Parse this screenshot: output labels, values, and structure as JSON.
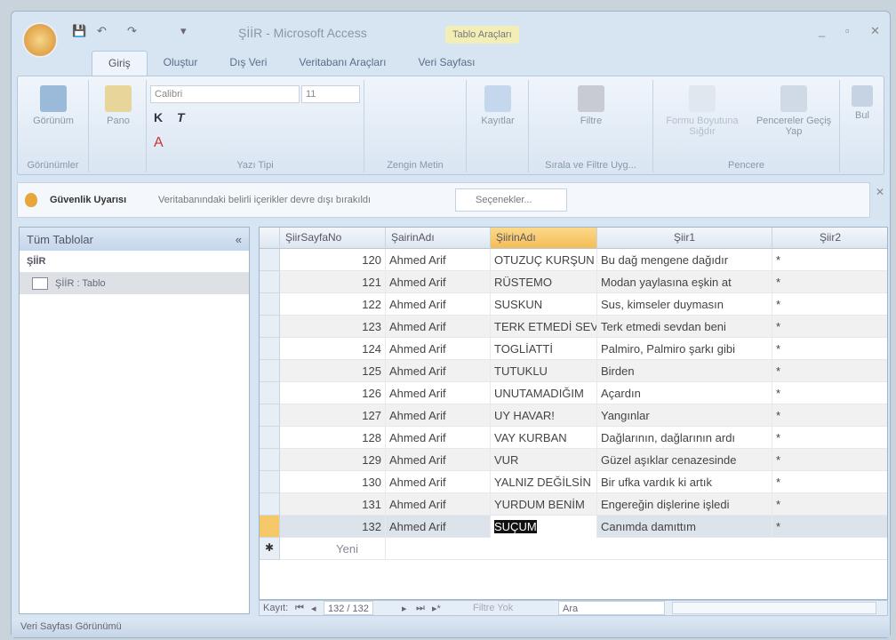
{
  "title": {
    "app": "ŞİİR - Microsoft Access",
    "context": "Tablo Araçları"
  },
  "tabs": [
    "Giriş",
    "Oluştur",
    "Dış Veri",
    "Veritabanı Araçları",
    "Veri Sayfası"
  ],
  "ribbon": {
    "view": "Görünüm",
    "paste": "Pano",
    "font_name": "Calibri",
    "font_size": "11",
    "font_group": "Yazı Tipi",
    "views_group": "Görünümler",
    "rich_text": "Zengin Metin",
    "records": "Kayıtlar",
    "filter": "Filtre",
    "sort_group": "Sırala ve Filtre Uyg...",
    "form_switch": "Formu Boyutuna Sığdır",
    "switch_windows": "Pencereler Geçiş Yap",
    "window_group": "Pencere",
    "find": "Bul"
  },
  "security": {
    "title": "Güvenlik Uyarısı",
    "message": "Veritabanındaki belirli içerikler devre dışı bırakıldı",
    "options": "Seçenekler..."
  },
  "nav": {
    "header": "Tüm Tablolar",
    "group": "ŞİİR",
    "item": "ŞİİR : Tablo"
  },
  "columns": [
    "ŞiirSayfaNo",
    "ŞairinAdı",
    "ŞiirinAdı",
    "Şiir1",
    "Şiir2"
  ],
  "rows": [
    [
      "120",
      "Ahmed Arif",
      "OTUZUÇ KURŞUN",
      "Bu dağ mengene dağıdır",
      "*"
    ],
    [
      "121",
      "Ahmed Arif",
      "RÜSTEMO",
      "Modan yaylasına eşkin at",
      "*"
    ],
    [
      "122",
      "Ahmed Arif",
      "SUSKUN",
      "Sus, kimseler duymasın",
      "*"
    ],
    [
      "123",
      "Ahmed Arif",
      "TERK ETMEDİ SEVDAN",
      "Terk etmedi sevdan beni",
      "*"
    ],
    [
      "124",
      "Ahmed Arif",
      "TOGLİATTİ",
      "Palmiro, Palmiro şarkı gibi",
      "*"
    ],
    [
      "125",
      "Ahmed Arif",
      "TUTUKLU",
      "Birden",
      "*"
    ],
    [
      "126",
      "Ahmed Arif",
      "UNUTAMADIĞIM",
      "Açardın",
      "*"
    ],
    [
      "127",
      "Ahmed Arif",
      "UY HAVAR!",
      "Yangınlar",
      "*"
    ],
    [
      "128",
      "Ahmed Arif",
      "VAY KURBAN",
      "Dağlarının, dağlarının ardı",
      "*"
    ],
    [
      "129",
      "Ahmed Arif",
      "VUR",
      "Güzel aşıklar cenazesinde",
      "*"
    ],
    [
      "130",
      "Ahmed Arif",
      "YALNIZ DEĞİLSİN",
      "Bir ufka vardık ki artık",
      "*"
    ],
    [
      "131",
      "Ahmed Arif",
      "YURDUM BENİM",
      "Engereğin dişlerine işledi",
      "*"
    ],
    [
      "132",
      "Ahmed Arif",
      "SUÇUM",
      "Canımda damıttım",
      "*"
    ]
  ],
  "new_row": "Yeni",
  "recnav": {
    "label": "Kayıt:",
    "position": "132 / 132",
    "filter": "Filtre Yok",
    "search": "Ara"
  },
  "status": "Veri Sayfası Görünümü"
}
